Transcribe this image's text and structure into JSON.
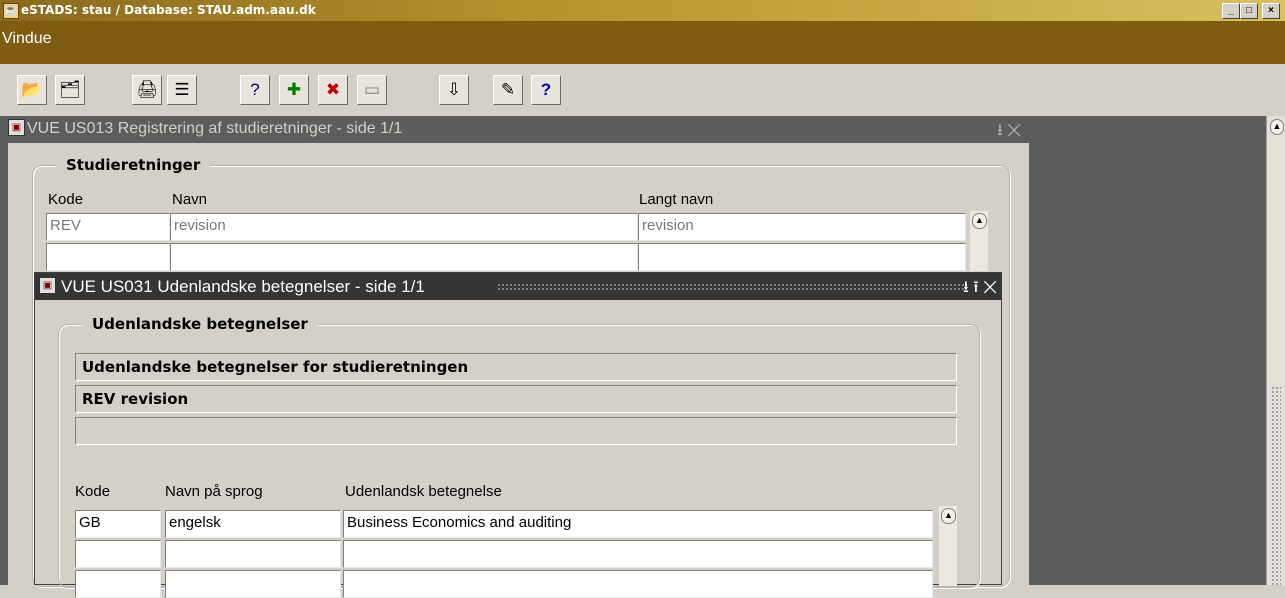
{
  "app": {
    "title": "eSTADS: stau / Database: STAU.adm.aau.dk",
    "window_buttons": [
      "_",
      "□",
      "×"
    ]
  },
  "menu": {
    "items": [
      {
        "label": "Vindue"
      }
    ]
  },
  "toolbar": {
    "buttons": [
      {
        "name": "open-folder-icon",
        "glyph": "📂"
      },
      {
        "name": "new-document-icon",
        "glyph": "🗂"
      },
      {
        "name": "print-icon",
        "glyph": "🖨"
      },
      {
        "name": "form-icon",
        "glyph": "☰"
      },
      {
        "name": "query-icon",
        "glyph": "?"
      },
      {
        "name": "insert-record-icon",
        "glyph": "✚"
      },
      {
        "name": "delete-record-icon",
        "glyph": "✖"
      },
      {
        "name": "clear-record-icon",
        "glyph": "▭"
      },
      {
        "name": "exit-icon",
        "glyph": "⇩"
      },
      {
        "name": "edit-icon",
        "glyph": "✎"
      },
      {
        "name": "help-icon",
        "glyph": "?"
      }
    ]
  },
  "window1": {
    "title": "VUE US013 Registrering af studieretninger - side 1/1",
    "controls": "⭳ ✕",
    "group_label": "Studieretninger",
    "columns": {
      "kode": "Kode",
      "navn": "Navn",
      "langt_navn": "Langt navn"
    },
    "rows": [
      {
        "kode": "REV",
        "navn": "revision",
        "langt_navn": "revision"
      },
      {
        "kode": "",
        "navn": "",
        "langt_navn": ""
      }
    ]
  },
  "window2": {
    "title": "VUE US031 Udenlandske betegnelser -  side 1/1",
    "controls": "⭳ ⭱ ✕",
    "group_label": "Udenlandske betegnelser",
    "info": [
      "Udenlandske betegnelser for studieretningen",
      "REV revision",
      ""
    ],
    "columns": {
      "kode": "Kode",
      "sprog": "Navn på sprog",
      "betegnelse": "Udenlandsk betegnelse"
    },
    "rows": [
      {
        "kode": "GB",
        "sprog": "engelsk",
        "betegnelse": "Business Economics and auditing"
      },
      {
        "kode": "",
        "sprog": "",
        "betegnelse": ""
      },
      {
        "kode": "",
        "sprog": "",
        "betegnelse": ""
      }
    ]
  }
}
